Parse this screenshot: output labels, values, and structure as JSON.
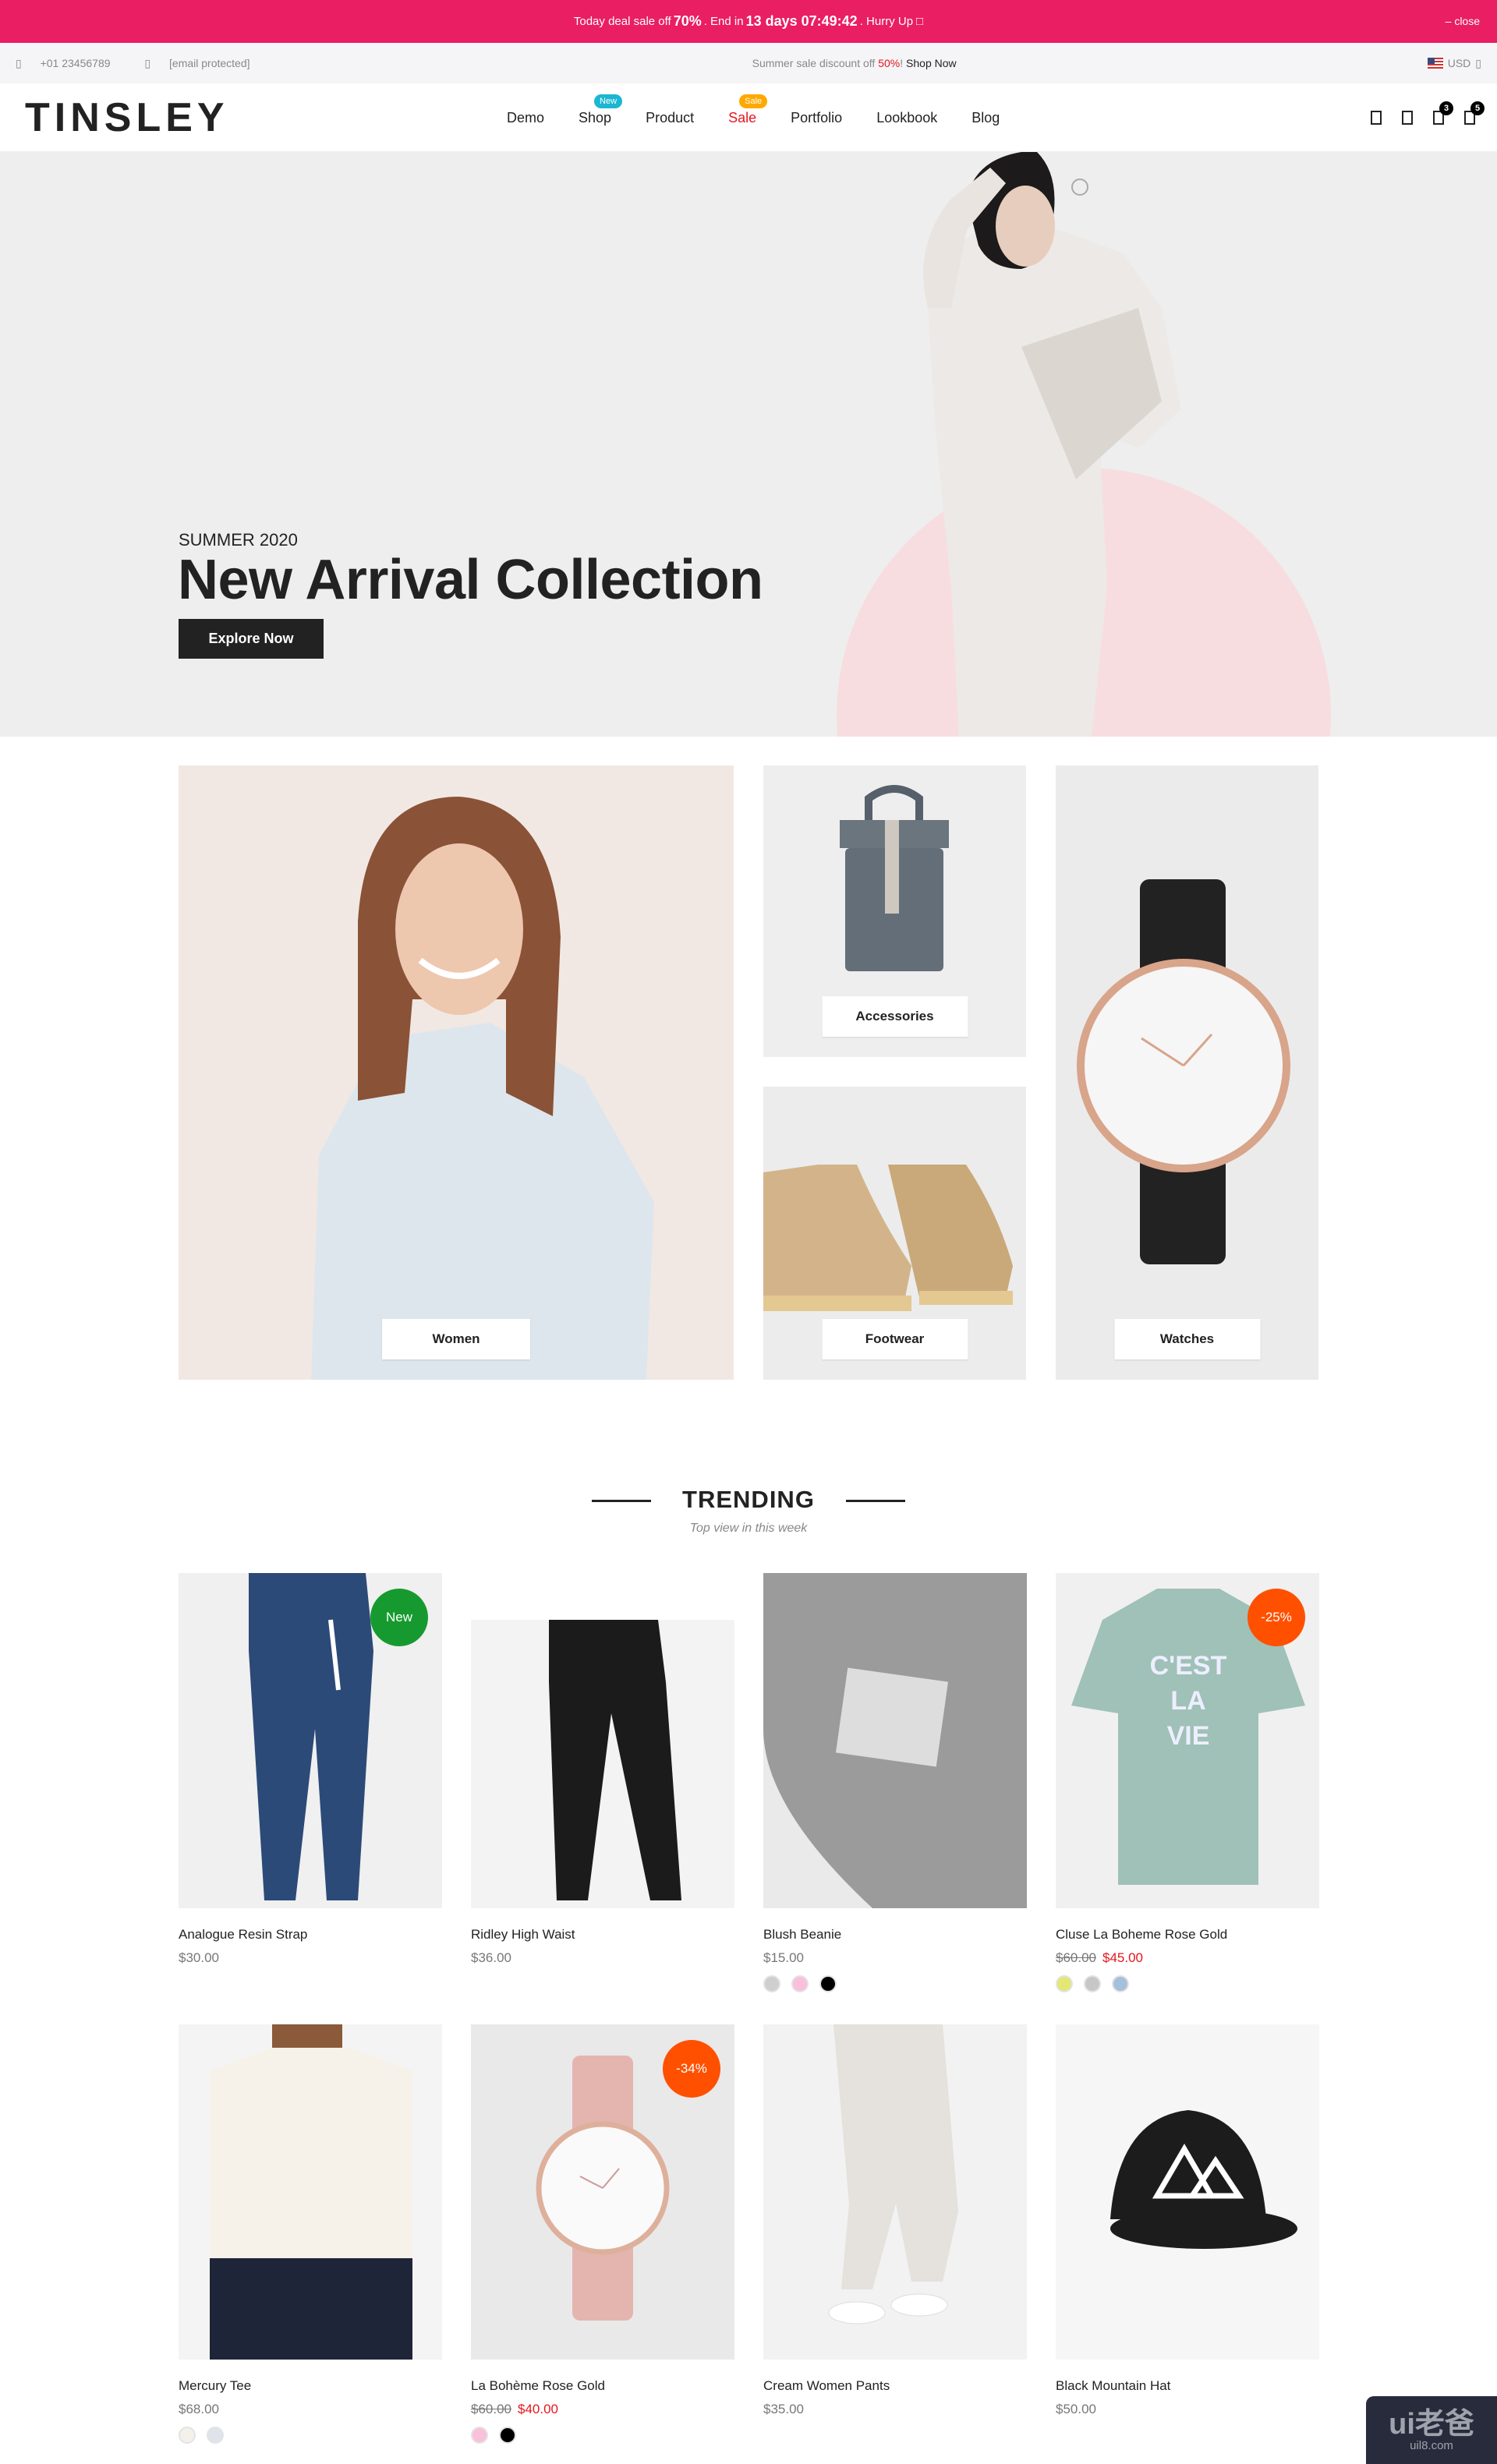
{
  "topbar": {
    "text1": "Today deal sale off",
    "pct": "70%",
    "text2": ". End in",
    "countdown": "13 days 07:49:42",
    "text3": ". Hurry Up",
    "close": "– close",
    "bg": "#e91e63"
  },
  "subbar": {
    "phone": "+01 23456789",
    "email": "[email protected]",
    "promo_text": "Summer sale discount off",
    "promo_pct": "50%",
    "promo_bang": "!",
    "promo_link": "Shop Now",
    "currency": "USD"
  },
  "header": {
    "logo": "TINSLEY",
    "nav": [
      {
        "label": "Demo"
      },
      {
        "label": "Shop",
        "badge": "New",
        "badge_color": "#1bb7d2"
      },
      {
        "label": "Product"
      },
      {
        "label": "Sale",
        "badge": "Sale",
        "badge_color": "#ffa800"
      },
      {
        "label": "Portfolio"
      },
      {
        "label": "Lookbook"
      },
      {
        "label": "Blog"
      }
    ],
    "icons": [
      "search-icon",
      "user-icon",
      "wishlist-icon",
      "cart-icon"
    ],
    "wishlist_count": "3",
    "cart_count": "5"
  },
  "hero": {
    "subtitle": "SUMMER 2020",
    "title": "New Arrival Collection",
    "button": "Explore Now",
    "slides": 3,
    "active_slide": 1
  },
  "categories": [
    {
      "label": "Women"
    },
    {
      "label": "Accessories"
    },
    {
      "label": "Footwear"
    },
    {
      "label": "Watches"
    }
  ],
  "trending": {
    "title": "TRENDING",
    "subtitle": "Top view in this week"
  },
  "products": [
    {
      "name": "Analogue Resin Strap",
      "price": "$30.00",
      "badge": "New",
      "badge_color": "#169a2f",
      "swatches": []
    },
    {
      "name": "Ridley High Waist",
      "price": "$36.00",
      "swatches": []
    },
    {
      "name": "Blush Beanie",
      "price": "$15.00",
      "swatches": [
        "#cfcfcf",
        "#f9c0dc",
        "#000000"
      ]
    },
    {
      "name": "Cluse La Boheme Rose Gold",
      "old_price": "$60.00",
      "price": "$45.00",
      "badge": "-25%",
      "badge_color": "#ff5000",
      "swatches": [
        "#e2e874",
        "#c7c7c7",
        "#a6bfdc"
      ]
    },
    {
      "name": "Mercury Tee",
      "price": "$68.00",
      "swatches": [
        "#f4f0ea",
        "#dfe3ea"
      ]
    },
    {
      "name": "La Bohème Rose Gold",
      "old_price": "$60.00",
      "price": "$40.00",
      "badge": "-34%",
      "badge_color": "#ff5000",
      "swatches": [
        "#f9c0dc",
        "#000000"
      ]
    },
    {
      "name": "Cream Women Pants",
      "price": "$35.00",
      "swatches": []
    },
    {
      "name": "Black Mountain Hat",
      "price": "$50.00",
      "swatches": []
    }
  ],
  "watermark": {
    "title": "ui老爸",
    "url": "uil8.com"
  }
}
